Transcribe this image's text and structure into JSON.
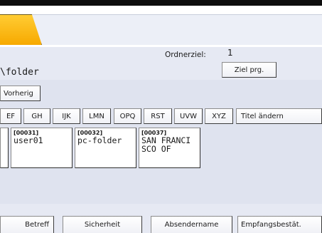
{
  "tabs": {
    "second_tab": ""
  },
  "address": {
    "folder_path": "\\folder",
    "ordnerziel_label": "Ordnerziel:",
    "ordnerziel_value": "1",
    "ziel_prg_label": "Ziel prg."
  },
  "nav": {
    "vorherig_label": "Vorherig"
  },
  "alpha_tabs": [
    "EF",
    "GH",
    "IJK",
    "LMN",
    "OPQ",
    "RST",
    "UVW",
    "XYZ",
    "Titel ändern"
  ],
  "entries": [
    {
      "num": "",
      "name": ""
    },
    {
      "num": "[00031]",
      "name": "user01"
    },
    {
      "num": "[00032]",
      "name": "pc-folder"
    },
    {
      "num": "[00037]",
      "name": "SAN FRANCI\nSCO OF"
    }
  ],
  "bottom_buttons": [
    "Betreff",
    "Sicherheit",
    "Absendername",
    "Empfangsbestät."
  ]
}
